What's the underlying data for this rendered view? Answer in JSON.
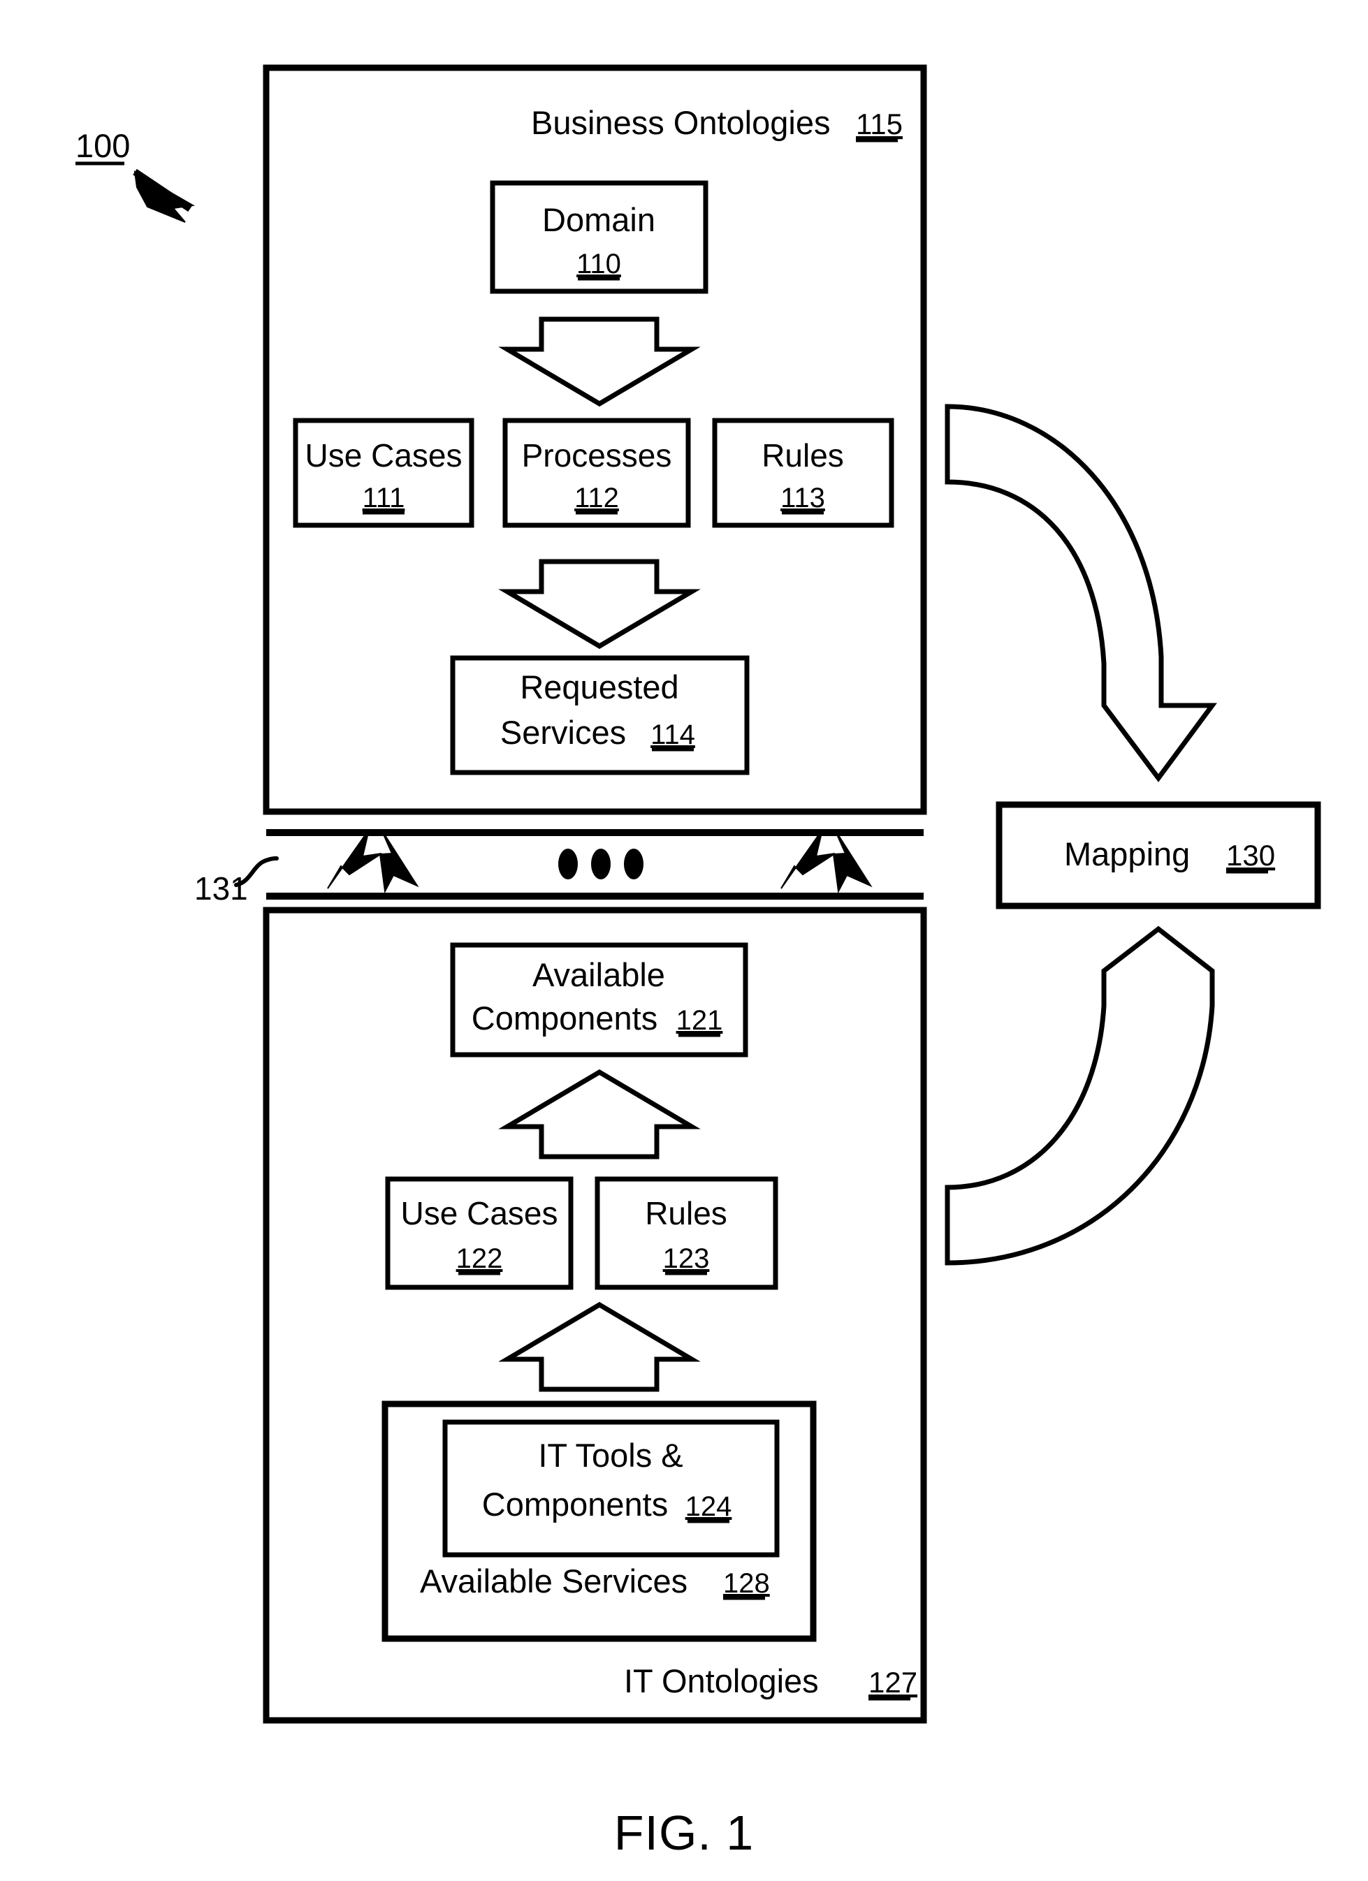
{
  "figure": {
    "caption": "FIG. 1",
    "system_ref": "100",
    "boundary_ref": "131",
    "ellipsis": "•••"
  },
  "business_ontologies": {
    "title": "Business Ontologies",
    "ref": "115",
    "domain": {
      "label": "Domain",
      "ref": "110"
    },
    "use_cases": {
      "label": "Use Cases",
      "ref": "111"
    },
    "processes": {
      "label": "Processes",
      "ref": "112"
    },
    "rules": {
      "label": "Rules",
      "ref": "113"
    },
    "requested_services": {
      "line1": "Requested",
      "line2": "Services",
      "ref": "114"
    }
  },
  "it_ontologies": {
    "title": "IT Ontologies",
    "ref": "127",
    "available_components": {
      "line1": "Available",
      "line2": "Components",
      "ref": "121"
    },
    "use_cases": {
      "label": "Use Cases",
      "ref": "122"
    },
    "rules": {
      "label": "Rules",
      "ref": "123"
    },
    "it_tools": {
      "line1": "IT Tools &",
      "line2": "Components",
      "ref": "124"
    },
    "available_services": {
      "label": "Available Services",
      "ref": "128"
    }
  },
  "mapping": {
    "label": "Mapping",
    "ref": "130"
  },
  "colors": {
    "stroke": "#000000",
    "fill": "#ffffff"
  }
}
